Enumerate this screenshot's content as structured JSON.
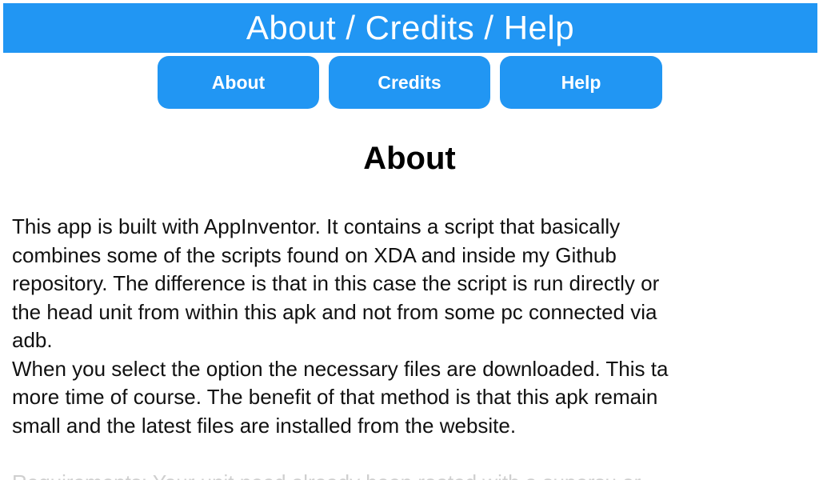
{
  "header": {
    "title": "About / Credits / Help"
  },
  "tabs": [
    {
      "label": "About"
    },
    {
      "label": "Credits"
    },
    {
      "label": "Help"
    }
  ],
  "section": {
    "heading": "About",
    "lines": [
      "This app is built with AppInventor. It contains a script that basically",
      "combines some of the scripts found on XDA and inside my Github",
      "repository. The difference is that in this case the script is run directly or",
      "the head unit from within this apk and not from some pc connected via",
      "adb.",
      "When you select the option the necessary files are downloaded. This ta",
      "more time of course. The benefit of that method is that this apk remain",
      "small and the latest files are installed from the website."
    ],
    "faded_line": "Requirements: Your unit need already been rooted with a supersu or"
  },
  "colors": {
    "accent": "#2196f3",
    "text": "#111111",
    "background": "#ffffff"
  }
}
